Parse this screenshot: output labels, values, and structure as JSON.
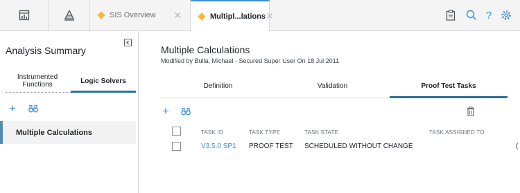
{
  "topbar": {
    "tabs": [
      {
        "label": "SIS Overview",
        "active": false
      },
      {
        "label": "Multipl...lations",
        "active": true
      }
    ],
    "tab_close_glyph": "✕",
    "icons": [
      "dashboard-icon",
      "triangle-stack-icon",
      "clipboard-icon",
      "search-icon",
      "help-icon",
      "gear-icon"
    ],
    "help_glyph": "?"
  },
  "left_panel": {
    "title": "Analysis Summary",
    "tabs": [
      {
        "label_line1": "Instrumented",
        "label_line2": "Functions",
        "active": false
      },
      {
        "label": "Logic Solvers",
        "active": true
      }
    ],
    "add_glyph": "+",
    "items": [
      {
        "label": "Multiple Calculations",
        "selected": true
      }
    ]
  },
  "main": {
    "title": "Multiple Calculations",
    "subtitle": "Modified by Bulla, Michael - Secured Super User On 18 Jul 2011",
    "tabs": [
      {
        "label": "Definition",
        "active": false
      },
      {
        "label": "Validation",
        "active": false
      },
      {
        "label": "Proof Test Tasks",
        "active": true
      }
    ],
    "add_glyph": "+",
    "table": {
      "columns": [
        "TASK ID",
        "TASK TYPE",
        "TASK STATE",
        "TASK ASSIGNED TO"
      ],
      "rows": [
        {
          "task_id": "V3.5.0 SP1",
          "task_type": "PROOF TEST",
          "task_state": "SCHEDULED WITHOUT CHANGE",
          "assigned_to": "("
        }
      ]
    }
  },
  "colors": {
    "accent_blue": "#3d8fd6",
    "active_underline": "#2d6f99",
    "tab_diamond": "#f4b73a"
  }
}
